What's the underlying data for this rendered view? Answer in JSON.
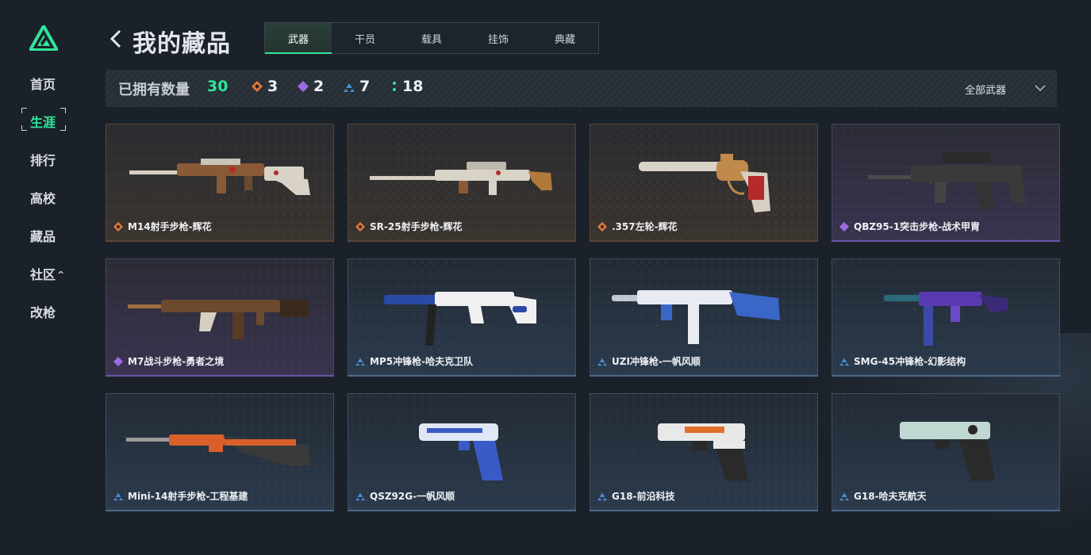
{
  "sidebar": {
    "logo": "app-logo",
    "items": [
      {
        "label": "首页"
      },
      {
        "label": "生涯"
      },
      {
        "label": "排行"
      },
      {
        "label": "高校"
      },
      {
        "label": "藏品"
      },
      {
        "label": "社区"
      },
      {
        "label": "改枪"
      }
    ],
    "active_index": 1,
    "community_caret": "^"
  },
  "header": {
    "title": "我的藏品",
    "back_icon": "chevron-left-icon",
    "tabs": [
      {
        "label": "武器"
      },
      {
        "label": "干员"
      },
      {
        "label": "载具"
      },
      {
        "label": "挂饰"
      },
      {
        "label": "典藏"
      }
    ],
    "active_tab": 0
  },
  "stats": {
    "owned_label": "已拥有数量",
    "owned_count": "30",
    "tiers": [
      {
        "icon": "orange-diamond-icon",
        "count": "3",
        "color": "#e07a3a"
      },
      {
        "icon": "purple-diamond-icon",
        "count": "2",
        "color": "#9b6be0"
      },
      {
        "icon": "blue-triangle-icon",
        "count": "7",
        "color": "#4b8fd6"
      },
      {
        "icon": "green-dots-icon",
        "count": "18",
        "color": "#2fe59a"
      }
    ],
    "filter_label": "全部武器",
    "filter_icon": "chevron-down-icon"
  },
  "items": [
    {
      "name": "M14射手步枪-辉花",
      "rarity": "orange"
    },
    {
      "name": "SR-25射手步枪-辉花",
      "rarity": "orange"
    },
    {
      "name": ".357左轮-辉花",
      "rarity": "orange"
    },
    {
      "name": "QBZ95-1突击步枪-战术甲胄",
      "rarity": "purple"
    },
    {
      "name": "M7战斗步枪-勇者之境",
      "rarity": "purple"
    },
    {
      "name": "MP5冲锋枪-哈夫克卫队",
      "rarity": "blue"
    },
    {
      "name": "UZI冲锋枪-一帆风顺",
      "rarity": "blue"
    },
    {
      "name": "SMG-45冲锋枪-幻影结构",
      "rarity": "blue"
    },
    {
      "name": "Mini-14射手步枪-工程基建",
      "rarity": "blue"
    },
    {
      "name": "QSZ92G-一帆风顺",
      "rarity": "blue"
    },
    {
      "name": "G18-前沿科技",
      "rarity": "blue"
    },
    {
      "name": "G18-哈夫克航天",
      "rarity": "blue"
    }
  ],
  "colors": {
    "accent": "#2fe59a",
    "orange": "#e07a3a",
    "purple": "#9b6be0",
    "blue": "#4b8fd6"
  }
}
